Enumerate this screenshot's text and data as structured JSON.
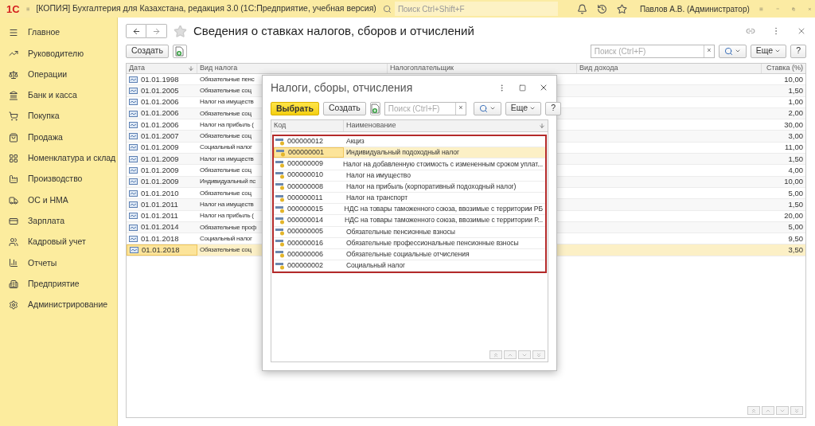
{
  "app": {
    "logo": "1С",
    "title": "[КОПИЯ] Бухгалтерия для Казахстана, редакция 3.0  (1С:Предприятие, учебная версия)",
    "search_placeholder": "Поиск Ctrl+Shift+F",
    "user": "Павлов А.В. (Администратор)"
  },
  "sidebar": {
    "items": [
      {
        "label": "Главное"
      },
      {
        "label": "Руководителю"
      },
      {
        "label": "Операции"
      },
      {
        "label": "Банк и касса"
      },
      {
        "label": "Покупка"
      },
      {
        "label": "Продажа"
      },
      {
        "label": "Номенклатура и склад"
      },
      {
        "label": "Производство"
      },
      {
        "label": "ОС и НМА"
      },
      {
        "label": "Зарплата"
      },
      {
        "label": "Кадровый учет"
      },
      {
        "label": "Отчеты"
      },
      {
        "label": "Предприятие"
      },
      {
        "label": "Администрирование"
      }
    ]
  },
  "form": {
    "title": "Сведения о ставках налогов, сборов и отчислений",
    "create": "Создать",
    "search_placeholder": "Поиск (Ctrl+F)",
    "clear": "×",
    "more": "Еще",
    "help": "?",
    "columns": [
      "Дата",
      "Вид налога",
      "Налогоплательщик",
      "Вид дохода",
      "Ставка (%)"
    ],
    "rows": [
      {
        "date": "01.01.1998",
        "tax": "Обязательные пенс",
        "rate": "10,00",
        "selected": false
      },
      {
        "date": "01.01.2005",
        "tax": "Обязательные соц",
        "rate": "1,50",
        "selected": false
      },
      {
        "date": "01.01.2006",
        "tax": "Налог на имуществ",
        "rate": "1,00",
        "selected": false
      },
      {
        "date": "01.01.2006",
        "tax": "Обязательные соц",
        "rate": "2,00",
        "selected": false
      },
      {
        "date": "01.01.2006",
        "tax": "Налог на прибыль (",
        "rate": "30,00",
        "selected": false
      },
      {
        "date": "01.01.2007",
        "tax": "Обязательные соц",
        "rate": "3,00",
        "selected": false
      },
      {
        "date": "01.01.2009",
        "tax": "Социальный налог",
        "rate": "11,00",
        "selected": false
      },
      {
        "date": "01.01.2009",
        "tax": "Налог на имуществ",
        "rate": "1,50",
        "selected": false
      },
      {
        "date": "01.01.2009",
        "tax": "Обязательные соц",
        "rate": "4,00",
        "selected": false
      },
      {
        "date": "01.01.2009",
        "tax": "Индивидуальный пс",
        "rate": "10,00",
        "selected": false
      },
      {
        "date": "01.01.2010",
        "tax": "Обязательные соц",
        "rate": "5,00",
        "selected": false
      },
      {
        "date": "01.01.2011",
        "tax": "Налог на имуществ",
        "rate": "1,50",
        "selected": false
      },
      {
        "date": "01.01.2011",
        "tax": "Налог на прибыль (",
        "rate": "20,00",
        "selected": false
      },
      {
        "date": "01.01.2014",
        "tax": "Обязательные проф",
        "rate": "5,00",
        "selected": false
      },
      {
        "date": "01.01.2018",
        "tax": "Социальный налог",
        "rate": "9,50",
        "selected": false
      },
      {
        "date": "01.01.2018",
        "tax": "Обязательные соц",
        "rate": "3,50",
        "selected": true
      }
    ]
  },
  "dialog": {
    "title": "Налоги, сборы, отчисления",
    "choose": "Выбрать",
    "create": "Создать",
    "search_placeholder": "Поиск (Ctrl+F)",
    "clear": "×",
    "more": "Еще",
    "help": "?",
    "columns": [
      "Код",
      "Наименование"
    ],
    "rows": [
      {
        "code": "000000012",
        "name": "Акциз",
        "selected": false
      },
      {
        "code": "000000001",
        "name": "Индивидуальный подоходный налог",
        "selected": true
      },
      {
        "code": "000000009",
        "name": "Налог на добавленную стоимость с измененным сроком уплат...",
        "selected": false
      },
      {
        "code": "000000010",
        "name": "Налог на имущество",
        "selected": false
      },
      {
        "code": "000000008",
        "name": "Налог на прибыль (корпоративный подоходный налог)",
        "selected": false
      },
      {
        "code": "000000011",
        "name": "Налог на транспорт",
        "selected": false
      },
      {
        "code": "000000015",
        "name": "НДС на товары таможенного союза, ввозимые с территории РБ",
        "selected": false
      },
      {
        "code": "000000014",
        "name": "НДС на товары таможенного союза, ввозимые с территории Р...",
        "selected": false
      },
      {
        "code": "000000005",
        "name": "Обязательные пенсионные взносы",
        "selected": false
      },
      {
        "code": "000000016",
        "name": "Обязательные профессиональные пенсионные взносы",
        "selected": false
      },
      {
        "code": "000000006",
        "name": "Обязательные социальные отчисления",
        "selected": false
      },
      {
        "code": "000000002",
        "name": "Социальный налог",
        "selected": false
      }
    ]
  }
}
